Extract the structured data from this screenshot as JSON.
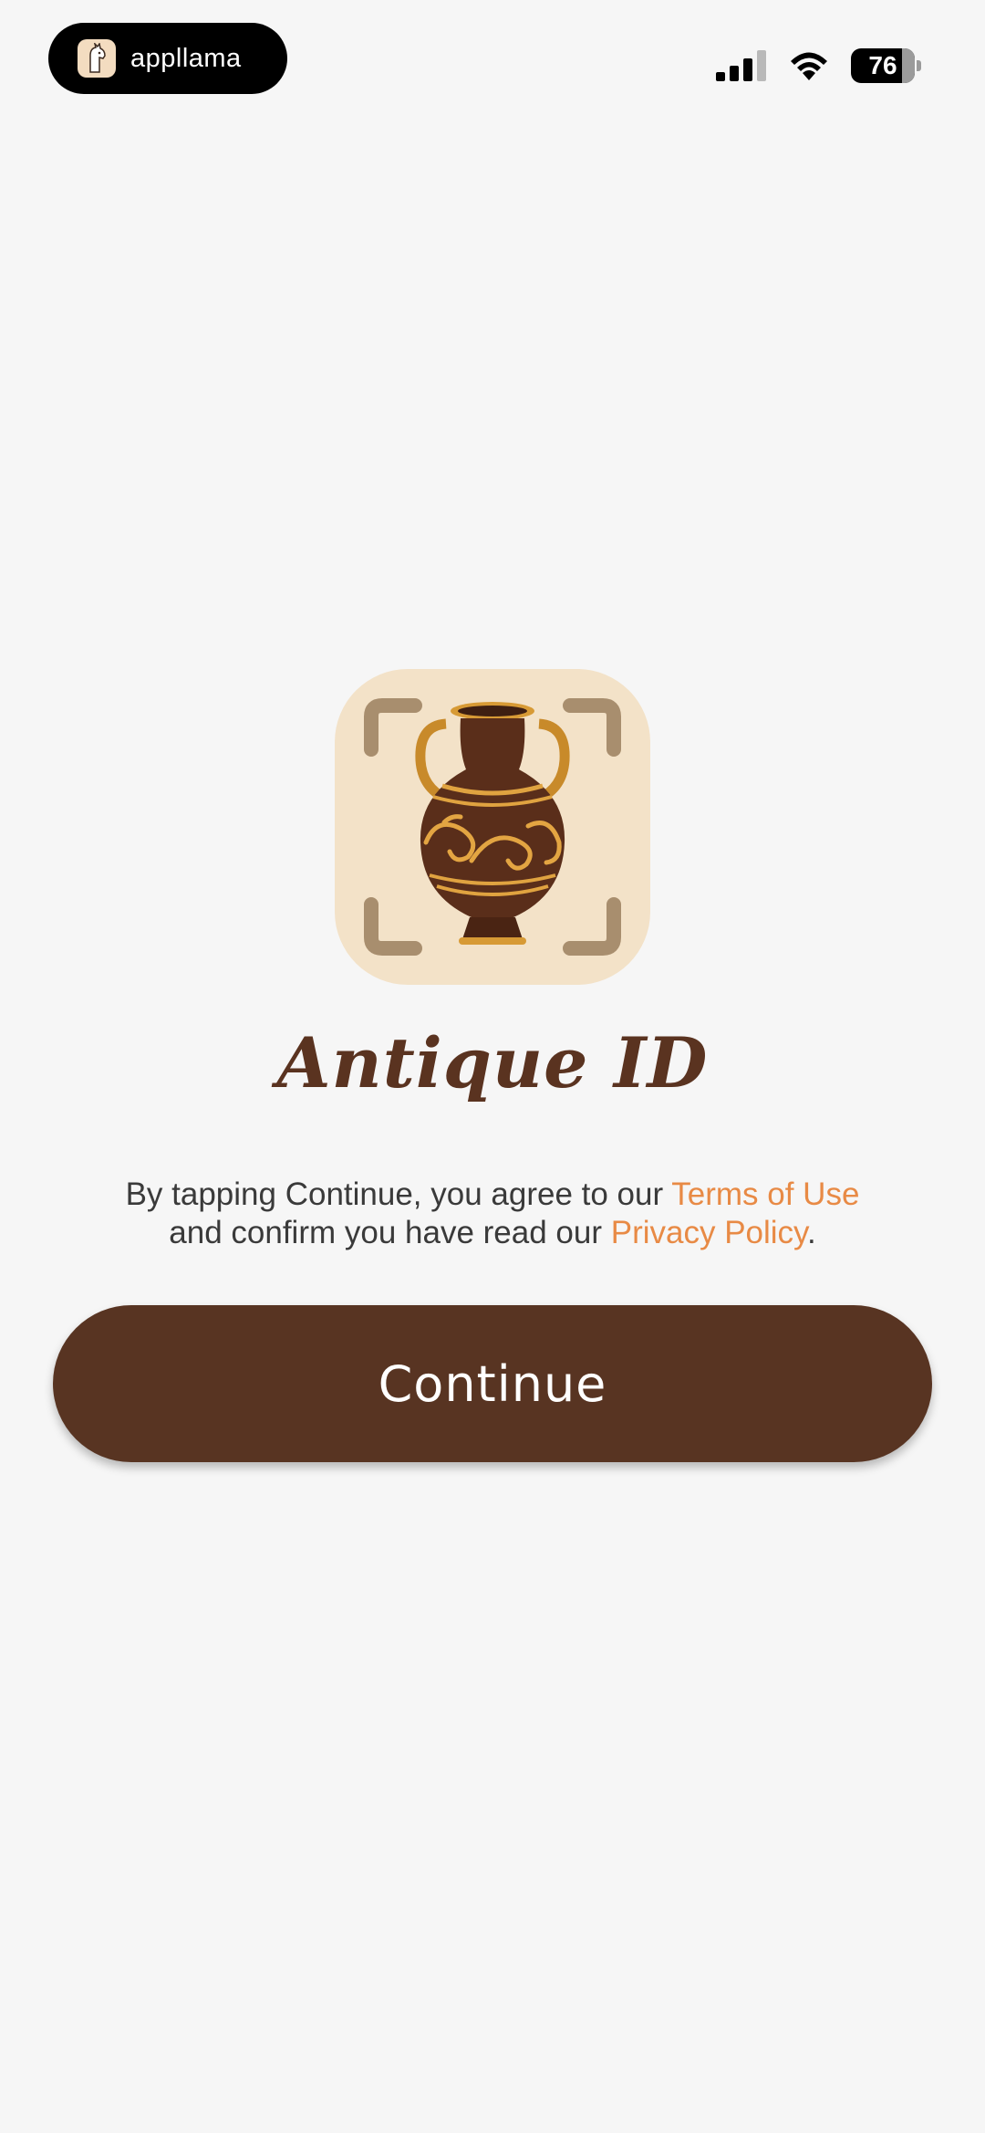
{
  "status_bar": {
    "app_badge_name": "appllama",
    "battery_percent": "76",
    "signal_bars_active": 3,
    "signal_bars_total": 4
  },
  "app": {
    "icon": "amphora-scan-icon",
    "title": "Antique ID"
  },
  "legal": {
    "line1_prefix": "By tapping Continue, you agree to our ",
    "terms_link": "Terms of Use",
    "line2_prefix": "and confirm you have read our ",
    "privacy_link": "Privacy Policy",
    "line2_suffix": "."
  },
  "continue_button": {
    "label": "Continue"
  },
  "colors": {
    "background": "#f6f6f6",
    "brand_brown": "#583422",
    "link_orange": "#e88a45",
    "icon_cream": "#f3e2c8"
  }
}
